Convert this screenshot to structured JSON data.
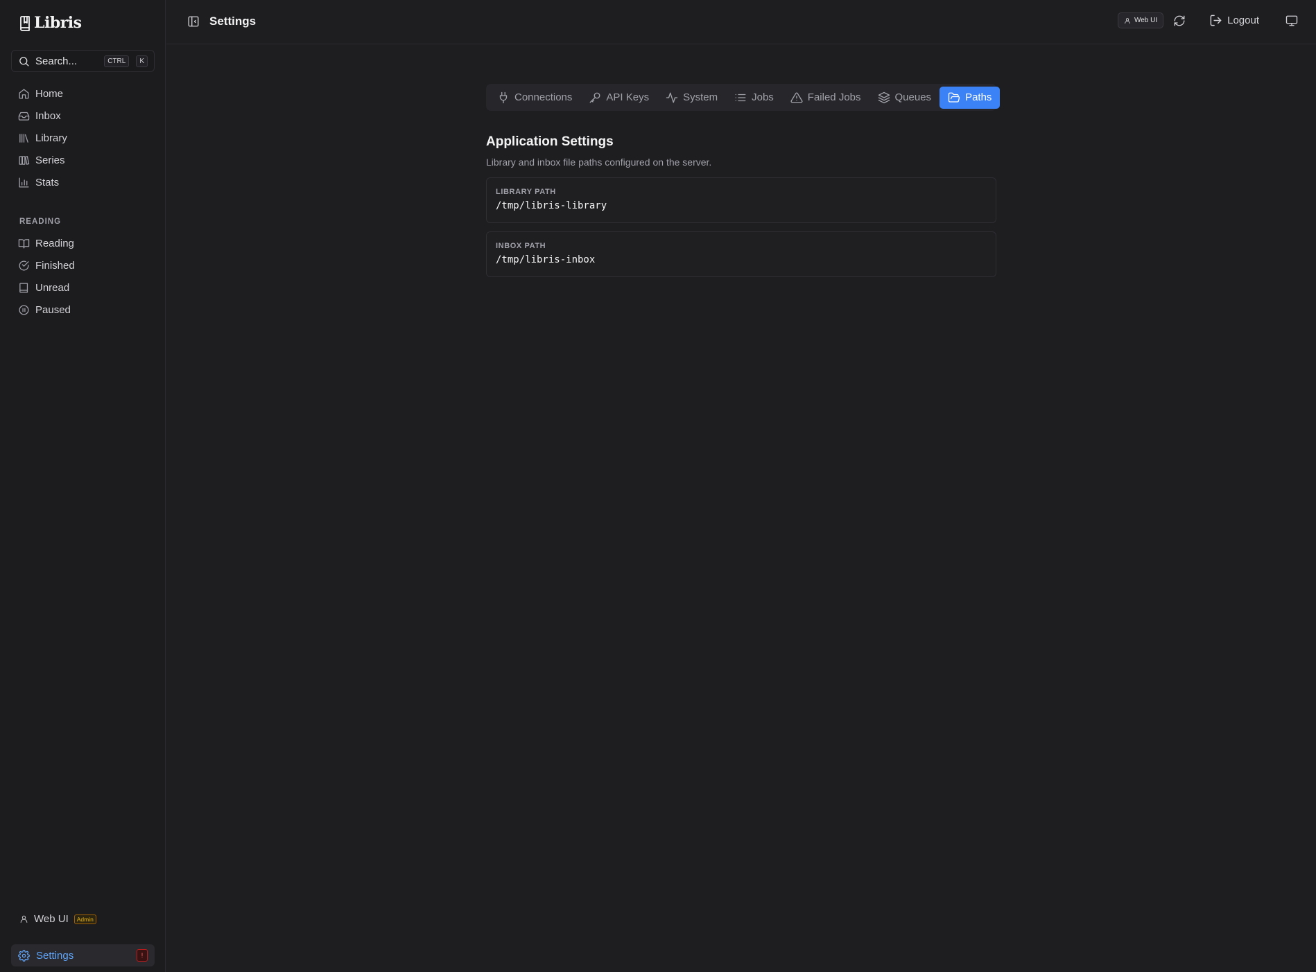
{
  "app": {
    "name": "Libris"
  },
  "search": {
    "label": "Search...",
    "kbd": [
      "CTRL",
      "K"
    ]
  },
  "sidebar": {
    "main_items": [
      {
        "label": "Home",
        "icon": "home-icon"
      },
      {
        "label": "Inbox",
        "icon": "inbox-icon"
      },
      {
        "label": "Library",
        "icon": "library-icon"
      },
      {
        "label": "Series",
        "icon": "series-icon"
      },
      {
        "label": "Stats",
        "icon": "bar-chart-icon"
      }
    ],
    "reading_label": "READING",
    "reading_items": [
      {
        "label": "Reading",
        "icon": "book-open-icon"
      },
      {
        "label": "Finished",
        "icon": "check-circle-icon"
      },
      {
        "label": "Unread",
        "icon": "book-icon"
      },
      {
        "label": "Paused",
        "icon": "pause-circle-icon"
      }
    ],
    "user": {
      "name": "Web UI",
      "role": "Admin"
    },
    "settings": {
      "label": "Settings",
      "badge": "!"
    }
  },
  "topbar": {
    "title": "Settings",
    "user_chip": "Web UI",
    "logout": "Logout"
  },
  "tabs": [
    {
      "label": "Connections",
      "icon": "plug-icon",
      "active": false
    },
    {
      "label": "API Keys",
      "icon": "key-icon",
      "active": false
    },
    {
      "label": "System",
      "icon": "activity-icon",
      "active": false
    },
    {
      "label": "Jobs",
      "icon": "list-icon",
      "active": false
    },
    {
      "label": "Failed Jobs",
      "icon": "alert-triangle-icon",
      "active": false
    },
    {
      "label": "Queues",
      "icon": "layers-icon",
      "active": false
    },
    {
      "label": "Paths",
      "icon": "folder-open-icon",
      "active": true
    }
  ],
  "content": {
    "title": "Application Settings",
    "description": "Library and inbox file paths configured on the server.",
    "paths": [
      {
        "label": "LIBRARY PATH",
        "value": "/tmp/libris-library"
      },
      {
        "label": "INBOX PATH",
        "value": "/tmp/libris-inbox"
      }
    ]
  },
  "colors": {
    "accent": "#3b82f6",
    "accent_text": "#60a5fa",
    "background": "#1e1e21",
    "sidebar": "#1c1c1f",
    "admin_badge": "#eab308",
    "alert_badge": "#f87171"
  }
}
